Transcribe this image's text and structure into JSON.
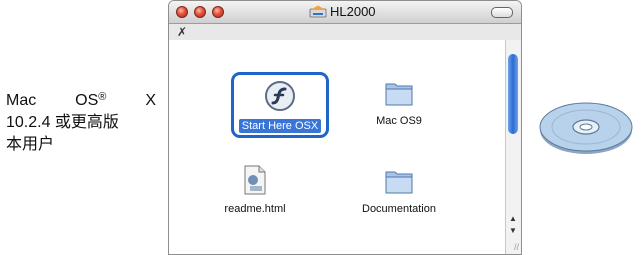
{
  "caption": {
    "os_name": "Mac",
    "os_brand": "OS",
    "registered": "®",
    "os_letter": "X",
    "line2": "10.2.4 或更高版",
    "line3": "本用户"
  },
  "window": {
    "title": "HL2000",
    "items": [
      {
        "label": "Start Here OSX",
        "icon": "flash-icon"
      },
      {
        "label": "Mac OS9",
        "icon": "folder-icon"
      },
      {
        "label": "readme.html",
        "icon": "html-file-icon"
      },
      {
        "label": "Documentation",
        "icon": "folder-icon"
      }
    ]
  },
  "colors": {
    "selection": "#1f64c8",
    "arrow": "#2f86e0",
    "scroll_thumb": "#2b6bd2",
    "cd_disc": "#b9d2ec"
  }
}
